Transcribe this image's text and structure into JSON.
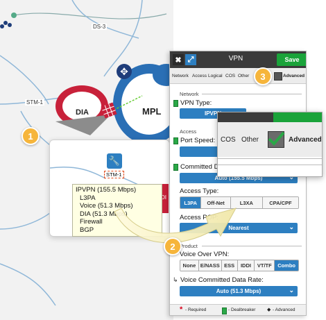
{
  "canvas": {
    "link_labels": [
      "DS-3",
      "STM-1"
    ],
    "nodes": {
      "dia": "DIA",
      "mpls": "MPL"
    },
    "callout": {
      "node_label": "STM-1",
      "partial_label": "DI",
      "services": [
        "IPVPN (155.5 Mbps)",
        "L3PA",
        "Voice (51.3 Mbps)",
        "DIA (51.3 Mbps)",
        "Firewall",
        "BGP"
      ]
    }
  },
  "steps": {
    "one": "1",
    "two": "2",
    "three": "3"
  },
  "panel": {
    "close_icon": "✖",
    "expand_icon": "⤢",
    "title": "VPN",
    "save_label": "Save",
    "tabs": [
      "Network",
      "Access",
      "Logical",
      "COS",
      "Other",
      "Advanced"
    ],
    "network_section": "Network",
    "vpn_type_label": "VPN Type:",
    "vpn_type_value": "IPVPN",
    "access_section": "Access",
    "port_speed_label": "Port Speed:",
    "committed_label": "Committed Data Rate:",
    "committed_value": "Auto (155.5 Mbps)",
    "access_type_label": "Access Type:",
    "access_types": [
      {
        "label": "L3PA",
        "selected": true
      },
      {
        "label": "Off-Net",
        "selected": false
      },
      {
        "label": "L3XA",
        "selected": false
      },
      {
        "label": "CPA/CPF",
        "selected": false
      }
    ],
    "access_pop_label": "Access POP:",
    "access_pop_value": "Nearest",
    "product_section": "Product",
    "voice_label": "Voice Over VPN:",
    "voice_options": [
      {
        "label": "None",
        "selected": false
      },
      {
        "label": "E/NASS",
        "selected": false
      },
      {
        "label": "ESS",
        "selected": false
      },
      {
        "label": "IDDI",
        "selected": false
      },
      {
        "label": "VT/TF",
        "selected": false
      },
      {
        "label": "Combo",
        "selected": true
      }
    ],
    "voice_rate_label": "Voice Committed Data Rate:",
    "voice_rate_value": "Auto (51.3 Mbps)",
    "footer": {
      "required": "- Required",
      "dealbreaker": "- Dealbreaker",
      "advanced": "- Advanced"
    }
  },
  "zoom": {
    "cos": "COS",
    "other": "Other",
    "advanced": "Advanced"
  },
  "colors": {
    "accent_blue": "#2d7fc1",
    "save_green": "#1aa33a",
    "step_orange": "#f6b53b",
    "cloud_red": "#c8213a"
  }
}
